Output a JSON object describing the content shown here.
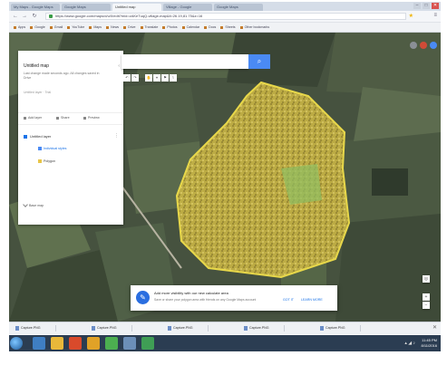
{
  "browser": {
    "tabs": [
      "My Maps - Google Maps",
      "Google Maps",
      "Untitled map",
      "Village - Google",
      "Google Maps"
    ],
    "active_tab": 2,
    "url": "https://www.google.com/maps/d/u/0/edit?mid=zAKeTuqQ-village-map&ll=26.19,81.75&z=16",
    "bookmarks": [
      "Apps",
      "Google",
      "Gmail",
      "YouTube",
      "Maps",
      "News",
      "Drive",
      "Translate",
      "Photos",
      "Calendar",
      "Docs",
      "Sheets",
      "Other bookmarks"
    ]
  },
  "map": {
    "panel": {
      "title": "Untitled map",
      "subtitle": "Last change made seconds ago. All changes saved in Drive",
      "description": "Untitled layer · Trial",
      "actions": [
        "Add layer",
        "Share",
        "Preview"
      ],
      "layer": {
        "name": "Untitled layer",
        "items": [
          "Individual styles",
          "Polygon"
        ],
        "colors": [
          "#4a8af4",
          "#e8c547"
        ]
      },
      "basemap": "Base map"
    },
    "search_placeholder": "",
    "toolbar": [
      "↶",
      "↷",
      "✋",
      "⌖",
      "⚑",
      "⌇"
    ],
    "notification": {
      "title": "Add more visibility with our new calculate area",
      "text": "Save or share your polygon area with friends on any Google Maps account",
      "links": [
        "GOT IT",
        "LEARN MORE"
      ]
    },
    "polygon_color": "#e3d054"
  },
  "downloads": [
    "Capture.PNG",
    "Capture.PNG",
    "Capture.PNG",
    "Capture.PNG",
    "Capture.PNG"
  ],
  "taskbar": {
    "time": "11:45 PM",
    "date": "8/11/2016"
  }
}
